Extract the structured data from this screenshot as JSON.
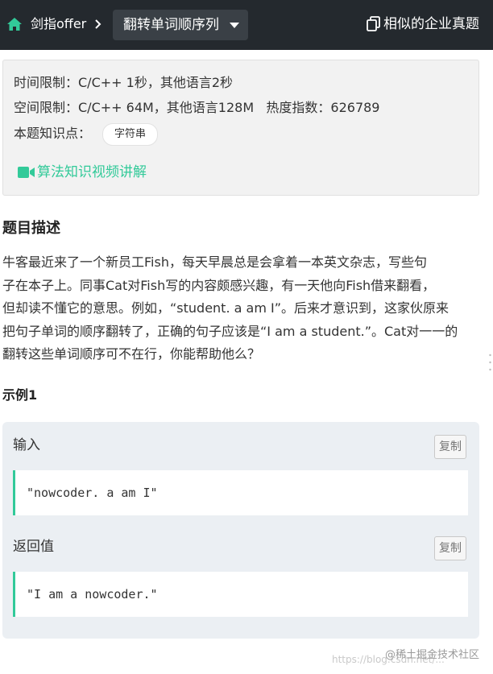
{
  "nav": {
    "breadcrumb": "剑指offer",
    "problem_title": "翻转单词顺序列",
    "similar_label": "相似的企业真题"
  },
  "info": {
    "time_limit": "时间限制：C/C++ 1秒，其他语言2秒",
    "space_limit": "空间限制：C/C++ 64M，其他语言128M   热度指数：626789",
    "knowledge_label": "本题知识点：",
    "tag": "字符串",
    "video_link": "算法知识视频讲解"
  },
  "description": {
    "title": "题目描述",
    "lines": [
      "牛客最近来了一个新员工Fish，每天早晨总是会拿着一本英文杂志，写些句",
      "子在本子上。同事Cat对Fish写的内容颇感兴趣，有一天他向Fish借来翻看，",
      "但却读不懂它的意思。例如，“student. a am I”。后来才意识到，这家伙原来",
      "把句子单词的顺序翻转了，正确的句子应该是“I am a student.”。Cat对一一的",
      "翻转这些单词顺序可不在行，你能帮助他么？"
    ]
  },
  "example": {
    "title": "示例1",
    "input_label": "输入",
    "input_value": "\"nowcoder. a am I\"",
    "output_label": "返回值",
    "output_value": "\"I am a nowcoder.\"",
    "copy_label": "复制"
  },
  "watermark": {
    "main": "@稀土掘金技术社区",
    "faint": "https://blog.csdn.net/..."
  },
  "colors": {
    "topbar": "#24292e",
    "accent": "#32ca99",
    "card_bg": "#f2f2f2",
    "example_bg": "#ebeff3"
  }
}
